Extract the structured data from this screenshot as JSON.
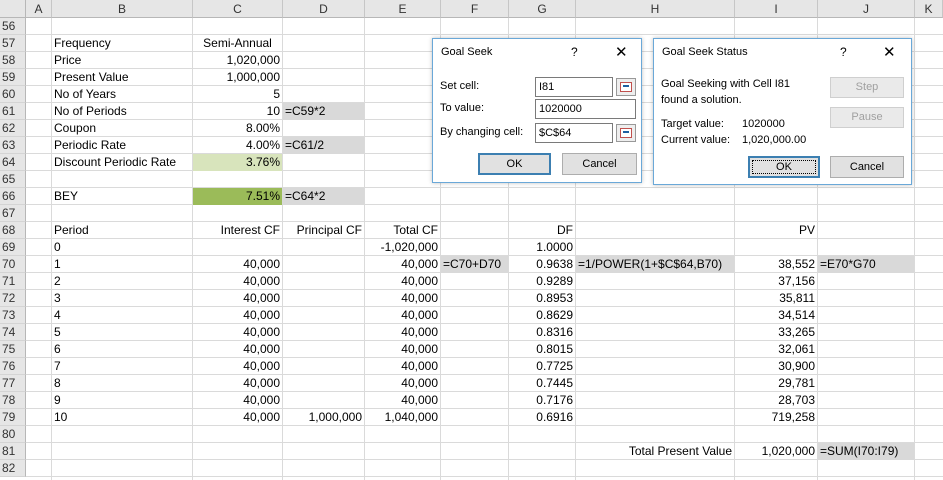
{
  "columns": [
    "A",
    "B",
    "C",
    "D",
    "E",
    "F",
    "G",
    "H",
    "I",
    "J",
    "K"
  ],
  "rows": [
    "56",
    "57",
    "58",
    "59",
    "60",
    "61",
    "62",
    "63",
    "64",
    "65",
    "66",
    "67",
    "68",
    "69",
    "70",
    "71",
    "72",
    "73",
    "74",
    "75",
    "76",
    "77",
    "78",
    "79",
    "80",
    "81",
    "82"
  ],
  "inputs": {
    "r57": {
      "label": "Frequency",
      "value": "Semi-Annual"
    },
    "r58": {
      "label": "Price",
      "value": "1,020,000"
    },
    "r59": {
      "label": "Present Value",
      "value": "1,000,000"
    },
    "r60": {
      "label": "No of Years",
      "value": "5"
    },
    "r61": {
      "label": "No of Periods",
      "value": "10",
      "formula": "=C59*2"
    },
    "r62": {
      "label": "Coupon",
      "value": "8.00%"
    },
    "r63": {
      "label": "Periodic Rate",
      "value": "4.00%",
      "formula": "=C61/2"
    },
    "r64": {
      "label": "Discount Periodic Rate",
      "value": "3.76%"
    },
    "r66": {
      "label": "BEY",
      "value": "7.51%",
      "formula": "=C64*2"
    }
  },
  "table": {
    "headers": {
      "period": "Period",
      "interest": "Interest CF",
      "principal": "Principal CF",
      "total": "Total CF",
      "df": "DF",
      "pv": "PV"
    },
    "rows": [
      {
        "period": "0",
        "interest": "",
        "principal": "",
        "total": "-1,020,000",
        "df": "1.0000",
        "pv": ""
      },
      {
        "period": "1",
        "interest": "40,000",
        "principal": "",
        "total": "40,000",
        "df": "0.9638",
        "pv": "38,552"
      },
      {
        "period": "2",
        "interest": "40,000",
        "principal": "",
        "total": "40,000",
        "df": "0.9289",
        "pv": "37,156"
      },
      {
        "period": "3",
        "interest": "40,000",
        "principal": "",
        "total": "40,000",
        "df": "0.8953",
        "pv": "35,811"
      },
      {
        "period": "4",
        "interest": "40,000",
        "principal": "",
        "total": "40,000",
        "df": "0.8629",
        "pv": "34,514"
      },
      {
        "period": "5",
        "interest": "40,000",
        "principal": "",
        "total": "40,000",
        "df": "0.8316",
        "pv": "33,265"
      },
      {
        "period": "6",
        "interest": "40,000",
        "principal": "",
        "total": "40,000",
        "df": "0.8015",
        "pv": "32,061"
      },
      {
        "period": "7",
        "interest": "40,000",
        "principal": "",
        "total": "40,000",
        "df": "0.7725",
        "pv": "30,900"
      },
      {
        "period": "8",
        "interest": "40,000",
        "principal": "",
        "total": "40,000",
        "df": "0.7445",
        "pv": "29,781"
      },
      {
        "period": "9",
        "interest": "40,000",
        "principal": "",
        "total": "40,000",
        "df": "0.7176",
        "pv": "28,703"
      },
      {
        "period": "10",
        "interest": "40,000",
        "principal": "1,000,000",
        "total": "1,040,000",
        "df": "0.6916",
        "pv": "719,258"
      }
    ],
    "formulas": {
      "total": "=C70+D70",
      "df": "=1/POWER(1+$C$64,B70)",
      "pv": "=E70*G70"
    },
    "total_label": "Total Present Value",
    "total_value": "1,020,000",
    "total_formula": "=SUM(I70:I79)"
  },
  "goal_seek": {
    "title": "Goal Seek",
    "help": "?",
    "close": "✕",
    "set_cell_label": "Set cell:",
    "set_cell_value": "I81",
    "to_value_label": "To value:",
    "to_value_value": "1020000",
    "changing_label": "By changing cell:",
    "changing_value": "$C$64",
    "ok": "OK",
    "cancel": "Cancel"
  },
  "goal_seek_status": {
    "title": "Goal Seek Status",
    "help": "?",
    "close": "✕",
    "message_line1": "Goal Seeking with Cell I81",
    "message_line2": "found a solution.",
    "target_label": "Target value:",
    "target_value": "1020000",
    "current_label": "Current value:",
    "current_value": "1,020,000.00",
    "step": "Step",
    "pause": "Pause",
    "ok": "OK",
    "cancel": "Cancel"
  }
}
